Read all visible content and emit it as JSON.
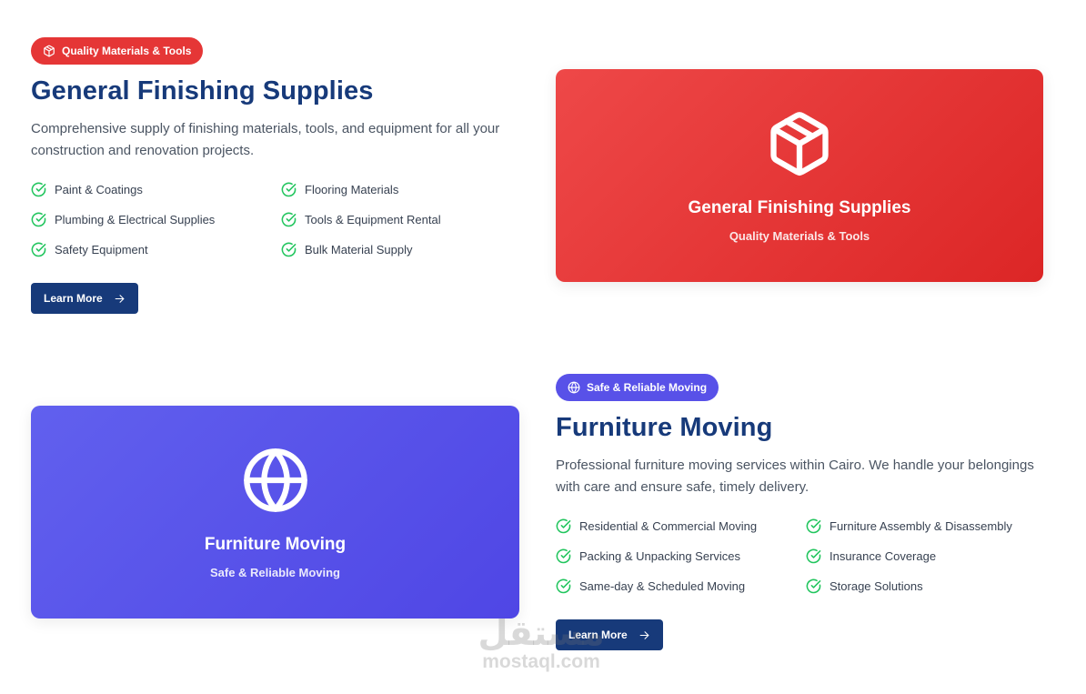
{
  "section1": {
    "badge": "Quality Materials & Tools",
    "title": "General Finishing Supplies",
    "description": "Comprehensive supply of finishing materials, tools, and equipment for all your construction and renovation projects.",
    "features": [
      "Paint & Coatings",
      "Flooring Materials",
      "Plumbing & Electrical Supplies",
      "Tools & Equipment Rental",
      "Safety Equipment",
      "Bulk Material Supply"
    ],
    "button": "Learn More",
    "card": {
      "title": "General Finishing Supplies",
      "subtitle": "Quality Materials & Tools",
      "icon": "box-icon"
    }
  },
  "section2": {
    "badge": "Safe & Reliable Moving",
    "title": "Furniture Moving",
    "description": "Professional furniture moving services within Cairo. We handle your belongings with care and ensure safe, timely delivery.",
    "features": [
      "Residential & Commercial Moving",
      "Furniture Assembly & Disassembly",
      "Packing & Unpacking Services",
      "Insurance Coverage",
      "Same-day & Scheduled Moving",
      "Storage Solutions"
    ],
    "button": "Learn More",
    "card": {
      "title": "Furniture Moving",
      "subtitle": "Safe & Reliable Moving",
      "icon": "globe-icon"
    }
  },
  "watermark": {
    "arabic": "مستقل",
    "latin": "mostaql.com"
  },
  "colors": {
    "primary_navy": "#173a7a",
    "accent_red": "#e53636",
    "accent_indigo": "#5851e8",
    "check_green": "#22c55e"
  }
}
